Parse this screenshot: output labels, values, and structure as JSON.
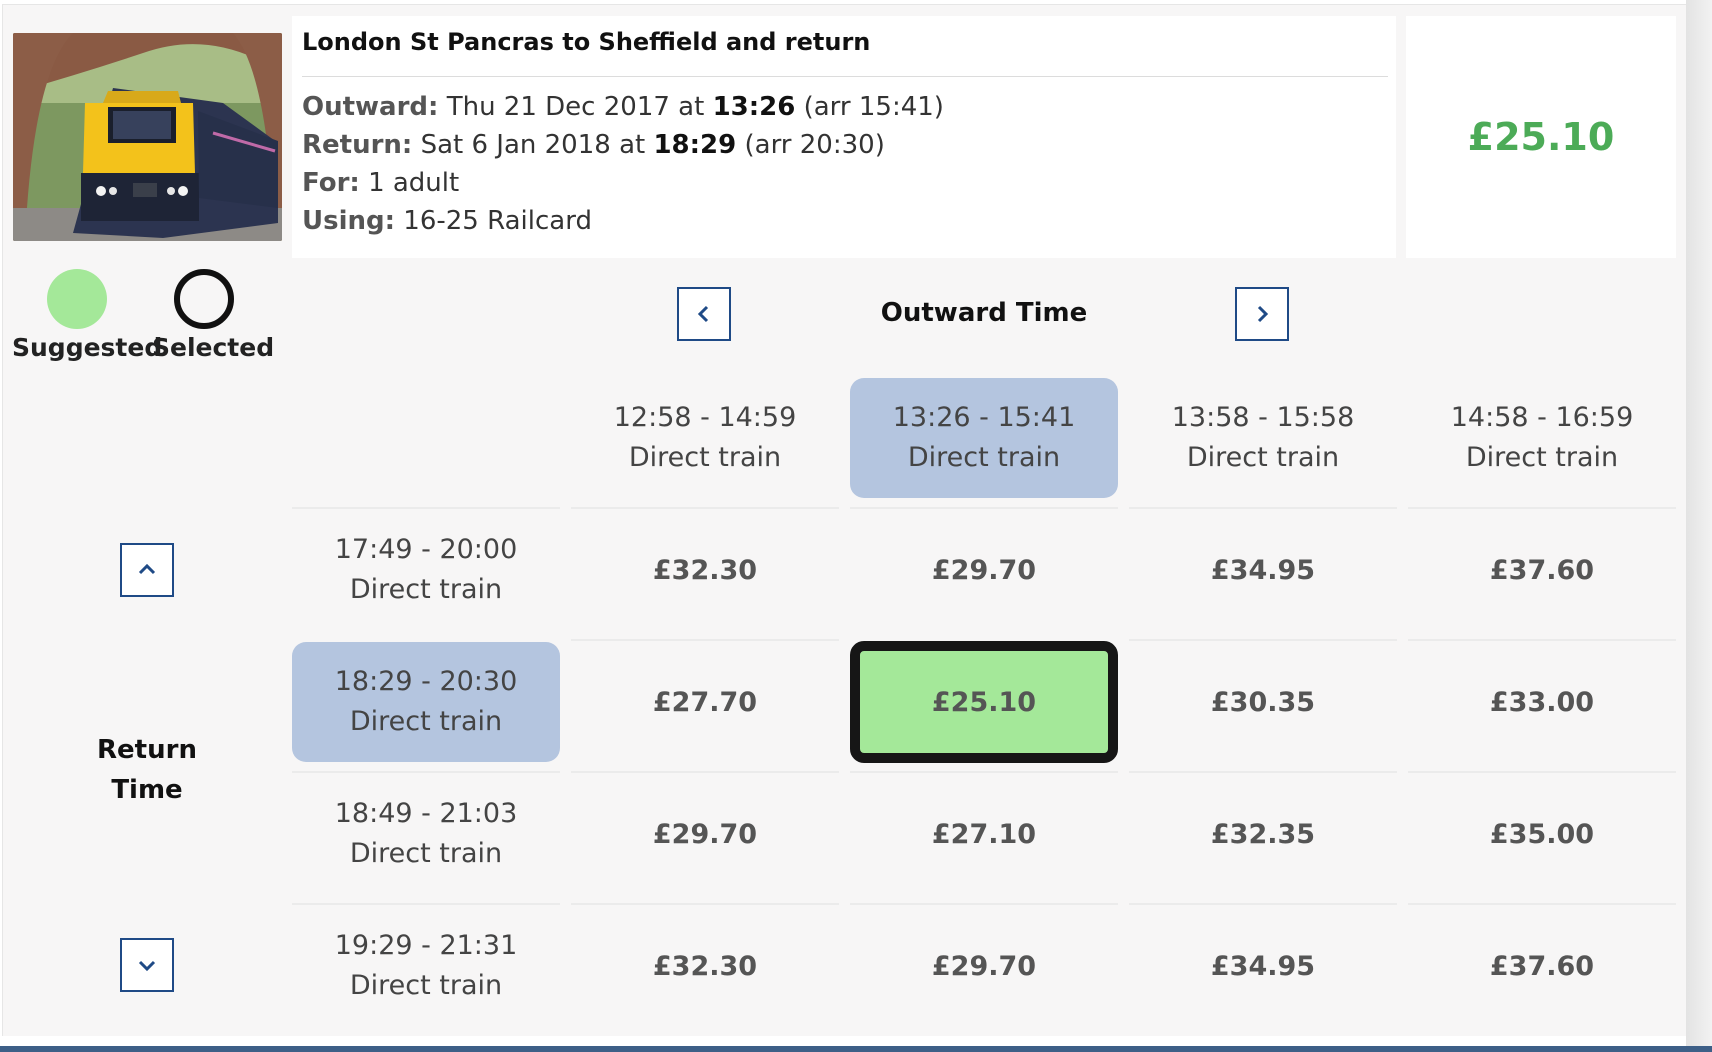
{
  "journey": {
    "title": "London St Pancras to Sheffield and return",
    "outward_label": "Outward:",
    "outward_date": "Thu 21 Dec 2017 at",
    "outward_time": "13:26",
    "outward_arr": "(arr 15:41)",
    "return_label": "Return:",
    "return_date": "Sat 6 Jan 2018 at",
    "return_time": "18:29",
    "return_arr": "(arr 20:30)",
    "for_label": "For:",
    "for_value": "1 adult",
    "using_label": "Using:",
    "using_value": "16-25 Railcard",
    "total_price": "£25.10"
  },
  "legend": {
    "suggested": "Suggested",
    "selected": "Selected"
  },
  "grid": {
    "outward_heading": "Outward Time",
    "return_heading_line1": "Return",
    "return_heading_line2": "Time",
    "outward_times": [
      {
        "time": "12:58 - 14:59",
        "type": "Direct train"
      },
      {
        "time": "13:26 - 15:41",
        "type": "Direct train"
      },
      {
        "time": "13:58 - 15:58",
        "type": "Direct train"
      },
      {
        "time": "14:58 - 16:59",
        "type": "Direct train"
      }
    ],
    "return_times": [
      {
        "time": "17:49 - 20:00",
        "type": "Direct train"
      },
      {
        "time": "18:29 - 20:30",
        "type": "Direct train"
      },
      {
        "time": "18:49 - 21:03",
        "type": "Direct train"
      },
      {
        "time": "19:29 - 21:31",
        "type": "Direct train"
      }
    ],
    "prices": [
      [
        "£32.30",
        "£29.70",
        "£34.95",
        "£37.60"
      ],
      [
        "£27.70",
        "£25.10",
        "£30.35",
        "£33.00"
      ],
      [
        "£29.70",
        "£27.10",
        "£32.35",
        "£35.00"
      ],
      [
        "£32.30",
        "£29.70",
        "£34.95",
        "£37.60"
      ]
    ],
    "active_outward_index": 1,
    "active_return_index": 1
  },
  "icons": {
    "prev_outward": "chevron-left-icon",
    "next_outward": "chevron-right-icon",
    "prev_return": "chevron-up-icon",
    "next_return": "chevron-down-icon"
  },
  "colors": {
    "suggested": "#a4e899",
    "active_time": "#b4c5df",
    "price_accent": "#4cab57",
    "nav_border": "#1f4a86"
  }
}
